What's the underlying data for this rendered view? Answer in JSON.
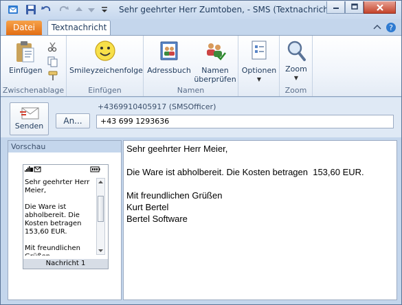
{
  "window": {
    "title": "Sehr geehrter Herr Zumtoben,  -  SMS (Textnachricht)"
  },
  "tabs": {
    "file": "Datei",
    "message": "Textnachricht"
  },
  "ribbon": {
    "clipboard": {
      "paste_label": "Einfügen",
      "group_label": "Zwischenablage"
    },
    "insert": {
      "smiley_label": "Smileyzeichenfolge",
      "group_label": "Einfügen"
    },
    "names": {
      "address_book_label": "Adressbuch",
      "check_names_line1": "Namen",
      "check_names_line2": "überprüfen",
      "group_label": "Namen"
    },
    "options": {
      "options_label": "Optionen"
    },
    "zoom": {
      "zoom_label": "Zoom",
      "group_label": "Zoom"
    }
  },
  "compose": {
    "send_label": "Senden",
    "to_button_label": "An...",
    "recipient_hint": "+4369910405917 (SMSOfficer)",
    "to_value": "+43 699 1293636"
  },
  "preview": {
    "header": "Vorschau",
    "phone_text": "Sehr geehrter Herr Meier,\n\nDie Ware ist abholbereit. Die Kosten betragen 153,60 EUR.\n\nMit freundlichen Grüßen",
    "footer": "Nachricht 1"
  },
  "message": {
    "body": "Sehr geehrter Herr Meier,\n\nDie Ware ist abholbereit. Die Kosten betragen  153,60 EUR.\n\nMit freundlichen Grüßen\nKurt Bertel\nBertel Software"
  },
  "colors": {
    "file_tab": "#e26b11",
    "close_button": "#c4442b",
    "window_chrome": "#c4d6ec"
  }
}
